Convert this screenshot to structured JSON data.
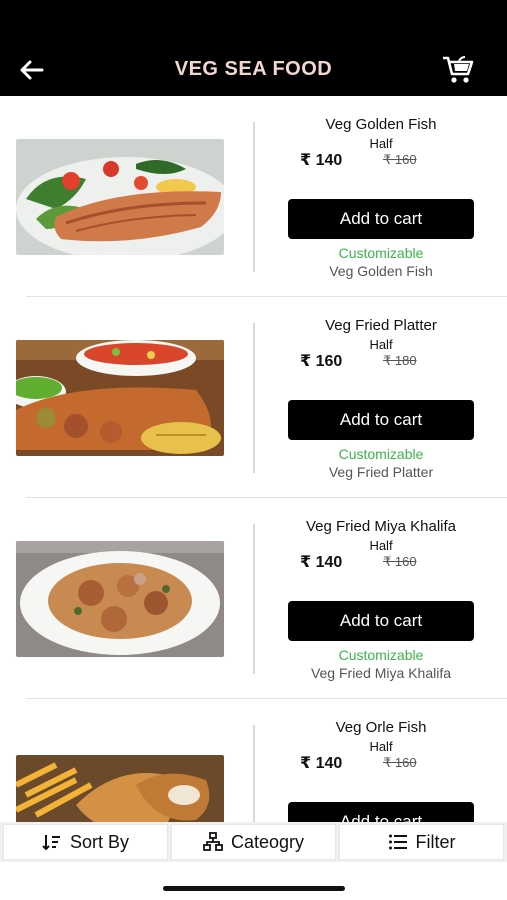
{
  "header": {
    "title": "VEG SEA FOOD",
    "back_icon": "arrow-left-icon",
    "cart_icon": "cart-icon",
    "background": "#000000",
    "title_color": "#f2d6cf"
  },
  "currency": "₹",
  "items": [
    {
      "name": "Veg Golden Fish",
      "size": "Half",
      "price": "₹ 140",
      "old_price": "₹ 160",
      "button": "Add to cart",
      "customizable": "Customizable",
      "subtitle": "Veg Golden Fish",
      "image": "grilled-fish-salad"
    },
    {
      "name": "Veg Fried Platter",
      "size": "Half",
      "price": "₹ 160",
      "old_price": "₹ 180",
      "button": "Add to cart",
      "customizable": "Customizable",
      "subtitle": "Veg Fried Platter",
      "image": "fried-platter"
    },
    {
      "name": "Veg Fried Miya Khalifa",
      "size": "Half",
      "price": "₹ 140",
      "old_price": "₹ 160",
      "button": "Add to cart",
      "customizable": "Customizable",
      "subtitle": "Veg Fried Miya Khalifa",
      "image": "curry-plate"
    },
    {
      "name": "Veg Orle Fish",
      "size": "Half",
      "price": "₹ 140",
      "old_price": "₹ 160",
      "button": "Add to cart",
      "customizable": "",
      "subtitle": "",
      "image": "fish-and-fries"
    }
  ],
  "bottombar": {
    "sort": "Sort By",
    "category": "Cateogry",
    "filter": "Filter"
  },
  "colors": {
    "accent_green": "#3cb44b",
    "button_bg": "#000000"
  }
}
